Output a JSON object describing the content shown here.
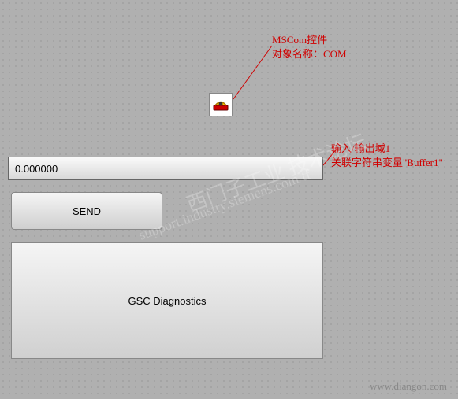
{
  "annotations": {
    "mscom_line1": "MSCom控件",
    "mscom_line2": "对象名称：COM",
    "io_line1": "输入/输出域1",
    "io_line2": "关联字符串变量\"Buffer1\""
  },
  "mscom_icon_name": "phone-icon",
  "io_field": {
    "value": "0.000000"
  },
  "buttons": {
    "send_label": "SEND"
  },
  "diagnostics": {
    "label": "GSC Diagnostics"
  },
  "watermark": {
    "line1": "西门子工业 技术论坛",
    "line2": "support.industry.siemens.com/tf"
  },
  "footer": {
    "text": "www.diangon.com"
  }
}
